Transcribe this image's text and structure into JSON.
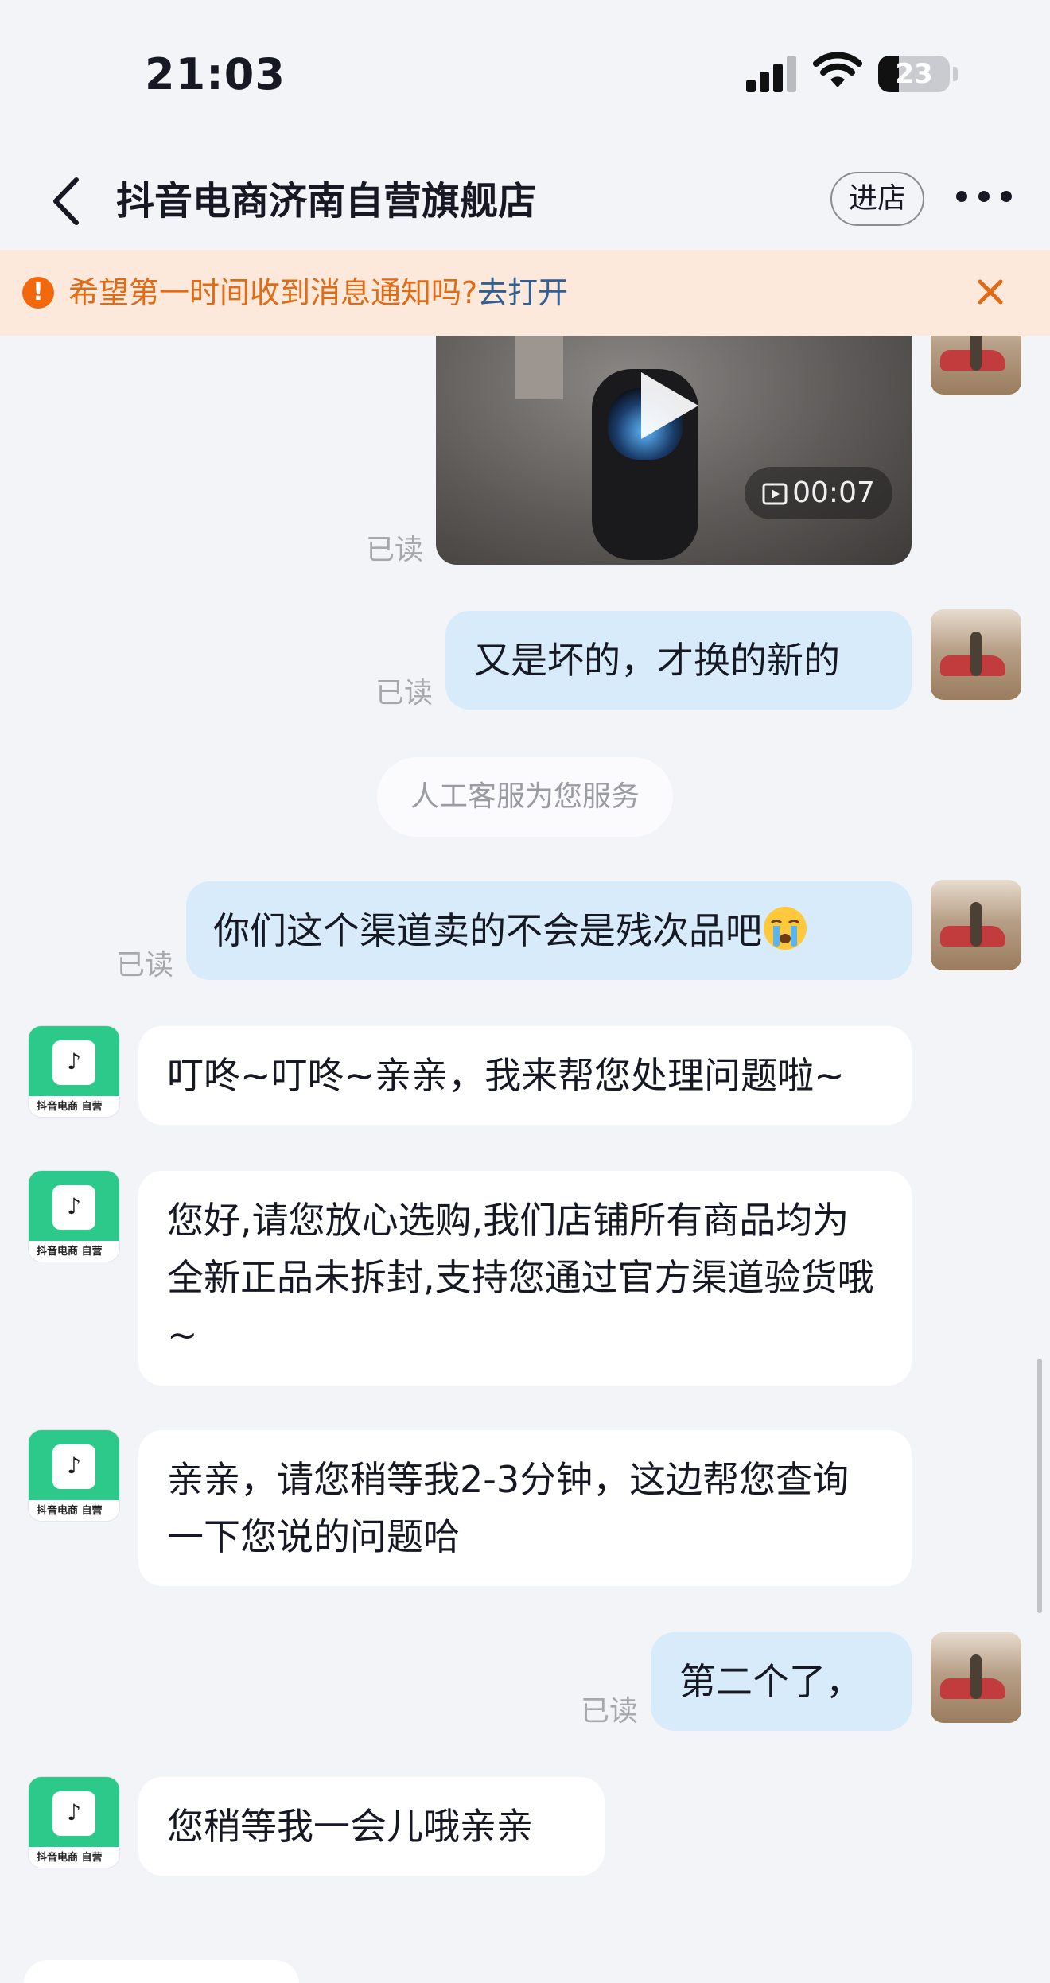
{
  "status_bar": {
    "time": "21:03",
    "battery": "23"
  },
  "header": {
    "title": "抖音电商济南自营旗舰店",
    "store_button": "进店"
  },
  "notice": {
    "text": "希望第一时间收到消息通知吗?",
    "link": "去打开"
  },
  "messages": {
    "video_duration": "00:07",
    "read_label": "已读",
    "m1": "又是坏的，才换的新的",
    "system": "人工客服为您服务",
    "m2": "你们这个渠道卖的不会是残次品吧",
    "m3": "叮咚~叮咚~亲亲，我来帮您处理问题啦~",
    "m4": "您好,请您放心选购,我们店铺所有商品均为全新正品未拆封,支持您通过官方渠道验货哦~",
    "m5": "亲亲，请您稍等我2-3分钟，这边帮您查询一下您说的问题哈",
    "m6": "第二个了，",
    "m7": "您稍等我一会儿哦亲亲"
  },
  "shop_avatar_caption": "抖音电商 自营",
  "colors": {
    "accent_orange": "#f2680c",
    "link_blue": "#2f5f95",
    "user_bubble": "#d7ebfb",
    "shop_green": "#2dc98a"
  },
  "icons": [
    "back-icon",
    "more-icon",
    "alert-icon",
    "close-icon",
    "play-icon",
    "signal-icon",
    "wifi-icon",
    "battery-icon"
  ]
}
